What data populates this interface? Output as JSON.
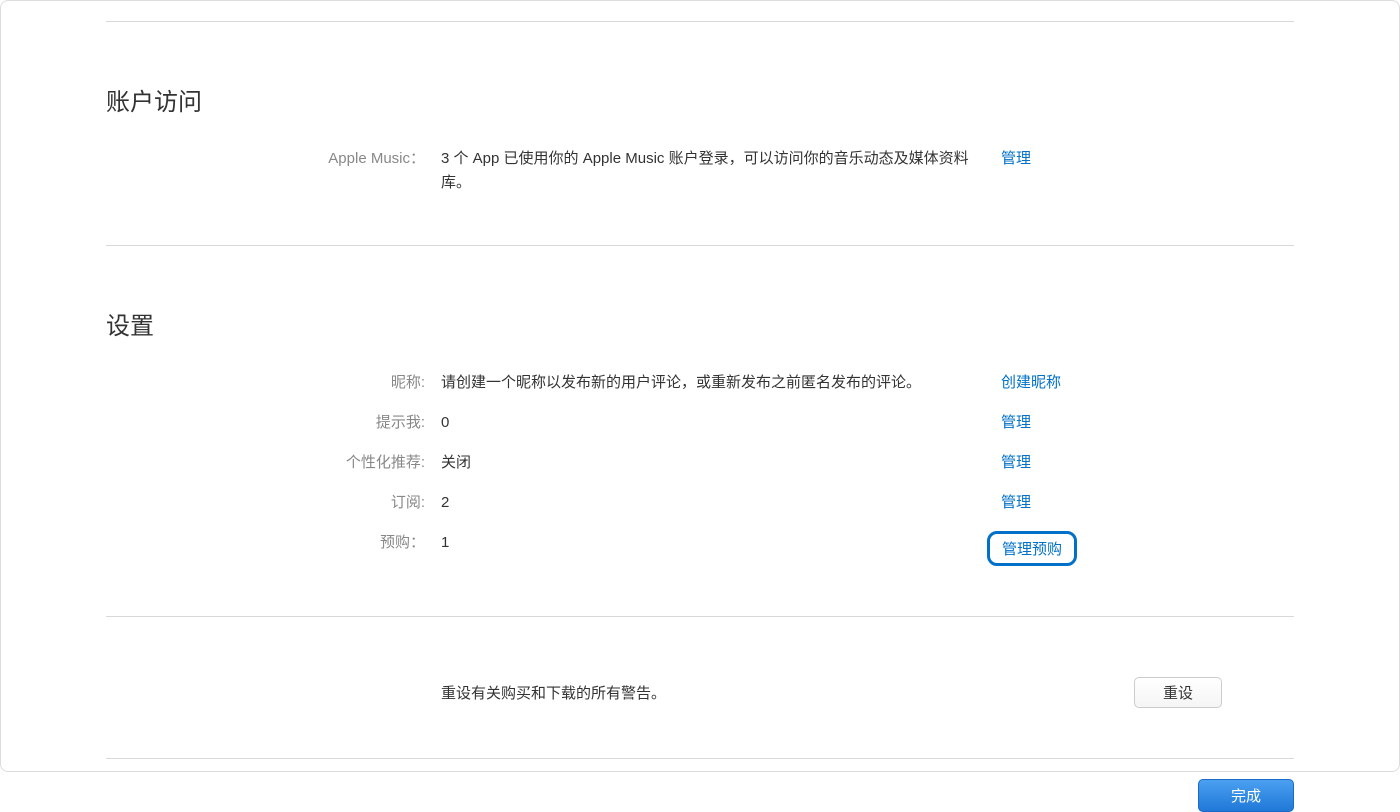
{
  "account_access": {
    "title": "账户访问",
    "apple_music_label": "Apple Music：",
    "apple_music_desc": "3 个 App 已使用你的 Apple Music 账户登录，可以访问你的音乐动态及媒体资料库。",
    "manage_link": "管理"
  },
  "settings": {
    "title": "设置",
    "nickname_label": "昵称:",
    "nickname_desc": "请创建一个昵称以发布新的用户评论，或重新发布之前匿名发布的评论。",
    "create_nickname_link": "创建昵称",
    "remind_me_label": "提示我:",
    "remind_me_value": "0",
    "remind_me_link": "管理",
    "personalized_label": "个性化推荐:",
    "personalized_value": "关闭",
    "personalized_link": "管理",
    "subscription_label": "订阅:",
    "subscription_value": "2",
    "subscription_link": "管理",
    "preorder_label": "预购：",
    "preorder_value": "1",
    "preorder_link": "管理预购"
  },
  "reset": {
    "text": "重设有关购买和下载的所有警告。",
    "button": "重设"
  },
  "done_button": "完成"
}
